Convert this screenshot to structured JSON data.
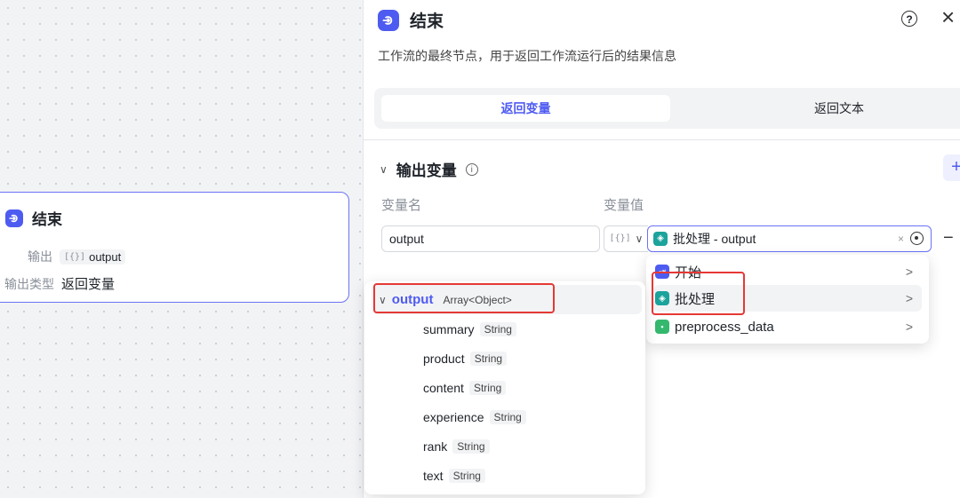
{
  "canvas_node": {
    "title": "结束",
    "output_label": "输出",
    "output_value": "output",
    "output_type_label": "输出类型",
    "output_type_value": "返回变量"
  },
  "panel": {
    "title": "结束",
    "description": "工作流的最终节点，用于返回工作流运行后的结果信息",
    "tabs": [
      {
        "label": "返回变量",
        "active": true
      },
      {
        "label": "返回文本",
        "active": false
      }
    ],
    "section_title": "输出变量",
    "columns": {
      "name": "变量名",
      "value": "变量值"
    },
    "row": {
      "name": "output",
      "value_node": "批处理",
      "value_sep": " - ",
      "value_var": "output",
      "clear": "×"
    }
  },
  "node_menu": {
    "items": [
      {
        "label": "开始",
        "icon": "start-node-icon"
      },
      {
        "label": "批处理",
        "icon": "batch-node-icon"
      },
      {
        "label": "preprocess_data",
        "icon": "code-node-icon"
      }
    ]
  },
  "var_menu": {
    "root": {
      "name": "output",
      "type": "Array<Object>"
    },
    "children": [
      {
        "name": "summary",
        "type": "String"
      },
      {
        "name": "product",
        "type": "String"
      },
      {
        "name": "content",
        "type": "String"
      },
      {
        "name": "experience",
        "type": "String"
      },
      {
        "name": "rank",
        "type": "String"
      },
      {
        "name": "text",
        "type": "String"
      }
    ]
  },
  "colors": {
    "accent": "#4e5bf1",
    "batch": "#1ba39c",
    "code": "#34b86d",
    "highlight_box": "#e53935"
  }
}
